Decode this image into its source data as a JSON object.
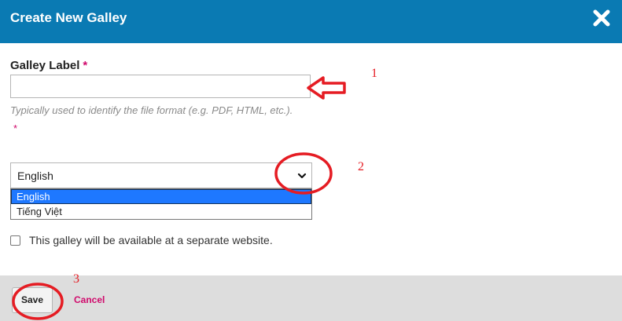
{
  "dialog": {
    "title": "Create New Galley",
    "close_icon": "close-icon"
  },
  "form": {
    "galley_label": {
      "label": "Galley Label",
      "required_mark": "*",
      "value": "",
      "help_text": "Typically used to identify the file format (e.g. PDF, HTML, etc.).",
      "help_required_mark": "*"
    },
    "locale": {
      "selected": "English",
      "options": [
        "English",
        "Tiếng Việt"
      ]
    },
    "remote": {
      "checked": false,
      "label": "This galley will be available at a separate website."
    }
  },
  "footer": {
    "save_label": "Save",
    "cancel_label": "Cancel"
  },
  "annotations": {
    "labels": [
      "1",
      "2",
      "3"
    ],
    "color": "#e51c23"
  },
  "colors": {
    "header_bg": "#0a7ab3",
    "accent": "#d00a6c",
    "footer_bg": "#dddddd",
    "option_highlight": "#1e78ff"
  }
}
